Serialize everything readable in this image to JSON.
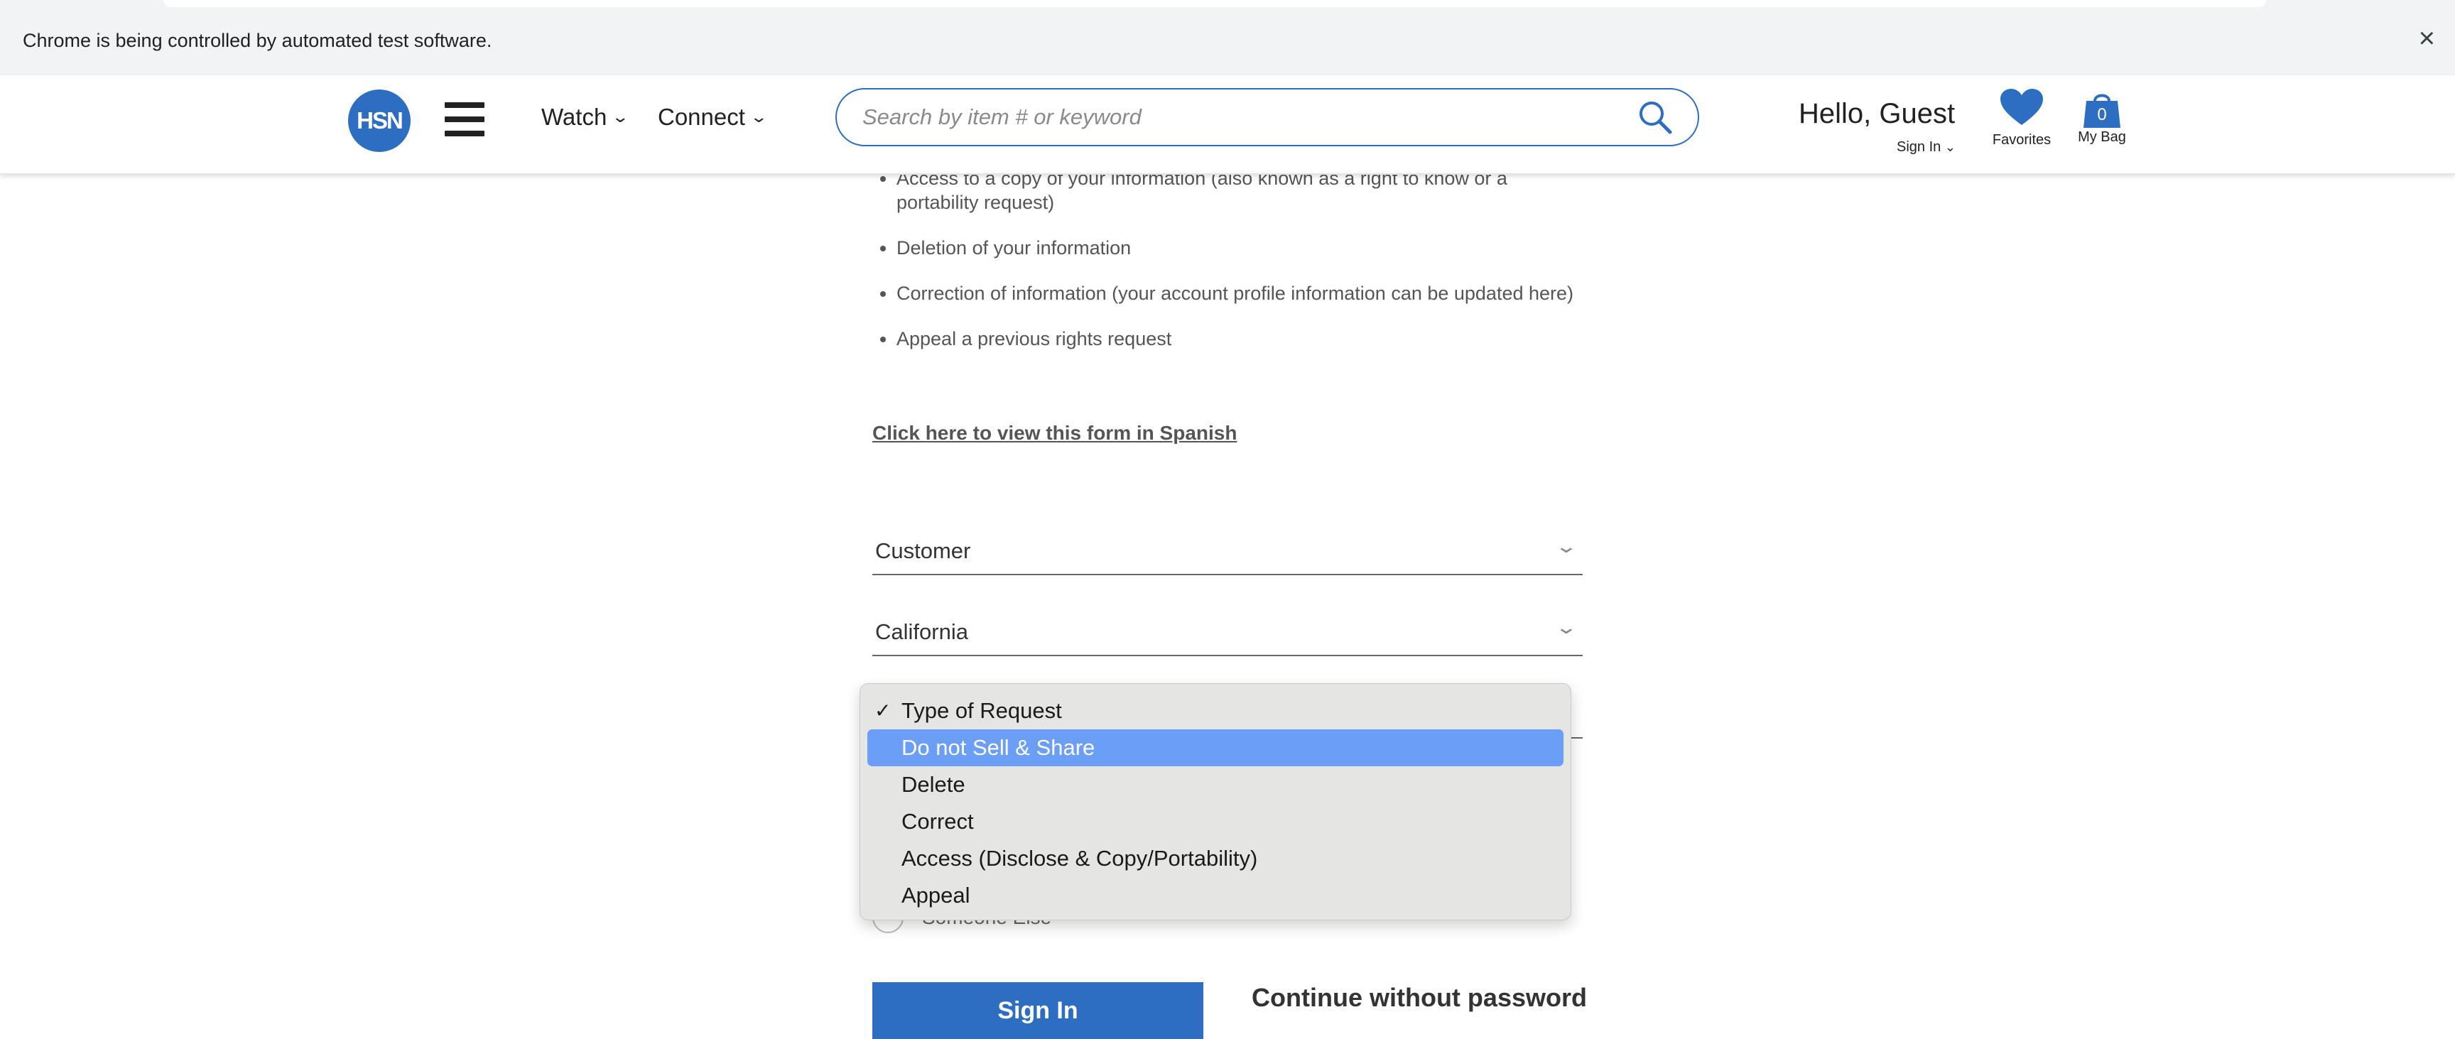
{
  "automation_bar": {
    "message": "Chrome is being controlled by automated test software.",
    "close": "×"
  },
  "header": {
    "logo": "HSN",
    "nav": [
      {
        "label": "Watch"
      },
      {
        "label": "Connect"
      }
    ],
    "search_placeholder": "Search by item # or keyword",
    "greeting": "Hello, Guest",
    "sign_in": "Sign In",
    "favorites": "Favorites",
    "bag_label": "My Bag",
    "bag_count": "0",
    "brand_color": "#2d6ec3"
  },
  "content": {
    "bullets": [
      "Access to a copy of your information (also known as a right to know or a portability request)",
      "Deletion of your information",
      "Correction of information (your account profile information can be updated here)",
      "Appeal a previous rights request"
    ],
    "spanish_link": "Click here to view this form in Spanish",
    "fields": [
      {
        "value": "Customer"
      },
      {
        "value": "California"
      }
    ],
    "radio_option": "Someone Else",
    "sign_in_button": "Sign In",
    "continue_link": "Continue without password"
  },
  "dropdown": {
    "check": "✓",
    "options": [
      {
        "label": "Type of Request",
        "checked": true
      },
      {
        "label": "Do not Sell & Share",
        "highlighted": true
      },
      {
        "label": "Delete"
      },
      {
        "label": "Correct"
      },
      {
        "label": "Access (Disclose & Copy/Portability)"
      },
      {
        "label": "Appeal"
      }
    ],
    "highlight_color": "#6b9ef6"
  }
}
